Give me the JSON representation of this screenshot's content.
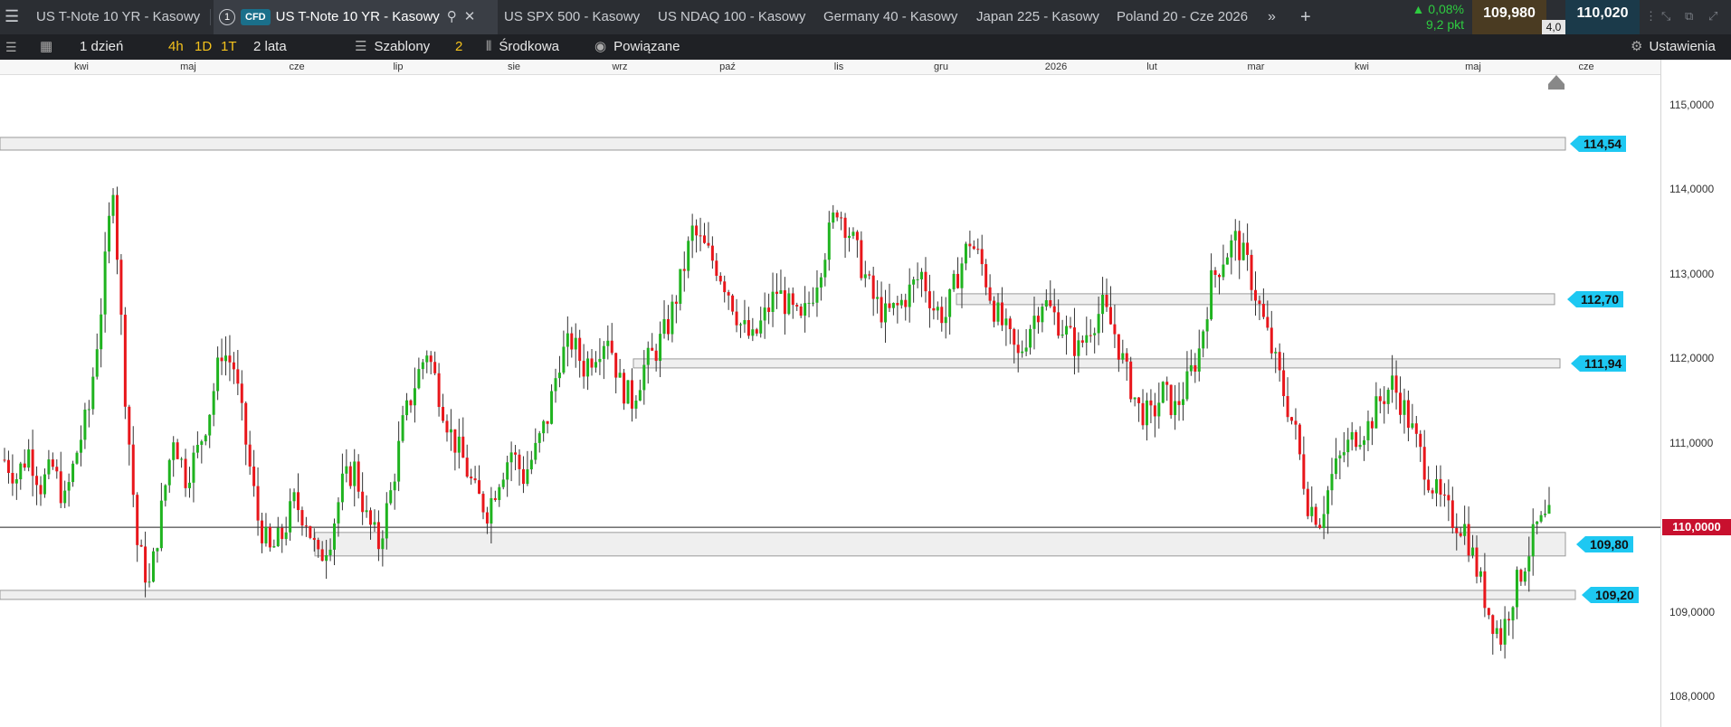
{
  "tabs": [
    {
      "label": "US T-Note 10 YR - Kasowy"
    },
    {
      "label": "US T-Note 10 YR - Kasowy",
      "index": "1",
      "badge": "CFD"
    },
    {
      "label": "US SPX 500 - Kasowy"
    },
    {
      "label": "US NDAQ 100 - Kasowy"
    },
    {
      "label": "Germany 40 - Kasowy"
    },
    {
      "label": "Japan 225 - Kasowy"
    },
    {
      "label": "Poland 20 - Cze 2026"
    }
  ],
  "quote": {
    "change_pct": "▲ 0,08%",
    "change_pts": "9,2 pkt",
    "sell": "109,980",
    "buy": "110,020",
    "spread": "4,0"
  },
  "toolbar": {
    "interval": "1 dzień",
    "tf1": "4h",
    "tf2": "1D",
    "tf3": "1T",
    "range": "2 lata",
    "templates": "Szablony",
    "templates_count": "2",
    "indicator": "Środkowa",
    "linked": "Powiązane",
    "settings": "Ustawienia"
  },
  "axis": {
    "months": [
      "kwi",
      "maj",
      "cze",
      "lip",
      "sie",
      "wrz",
      "paź",
      "lis",
      "gru",
      "2026",
      "lut",
      "mar",
      "kwi",
      "maj",
      "cze"
    ],
    "prices": [
      "115,0000",
      "114,0000",
      "113,0000",
      "112,0000",
      "111,0000",
      "110,0000",
      "109,0000",
      "108,0000"
    ],
    "current_price": "110,0000"
  },
  "levels": [
    "114,54",
    "112,70",
    "111,94",
    "109,80",
    "109,20"
  ],
  "colors": {
    "up": "#1fb31f",
    "down": "#e8161b",
    "tag": "#1ec8f2",
    "current": "#c8102e"
  },
  "chart_data": {
    "type": "candlestick",
    "ylim": [
      107.8,
      115.3
    ],
    "price_levels": [
      114.54,
      112.7,
      111.94,
      109.8,
      109.2
    ],
    "current": 110.0,
    "months": [
      "kwi",
      "maj",
      "cze",
      "lip",
      "sie",
      "wrz",
      "paź",
      "lis",
      "gru",
      "2026",
      "lut",
      "mar",
      "kwi",
      "maj",
      "cze"
    ],
    "path": [
      110.8,
      110.6,
      110.9,
      110.5,
      110.7,
      110.3,
      110.9,
      111.4,
      112.6,
      114.1,
      111.6,
      109.8,
      109.3,
      110.2,
      111.1,
      110.6,
      110.9,
      111.4,
      112.1,
      111.9,
      111.0,
      110.1,
      109.7,
      109.9,
      110.3,
      110.1,
      109.6,
      109.9,
      110.5,
      110.7,
      110.1,
      109.8,
      110.4,
      111.2,
      111.7,
      112.1,
      111.6,
      111.1,
      110.8,
      110.4,
      110.2,
      110.6,
      110.9,
      110.6,
      110.9,
      111.3,
      112.0,
      112.2,
      111.9,
      112.1,
      112.3,
      111.7,
      111.5,
      111.9,
      112.1,
      112.4,
      112.9,
      113.5,
      113.3,
      113.1,
      112.8,
      112.4,
      112.2,
      112.5,
      112.8,
      112.6,
      112.4,
      112.8,
      113.3,
      113.8,
      113.5,
      113.1,
      112.7,
      112.5,
      112.6,
      112.8,
      113.0,
      112.6,
      112.5,
      113.0,
      113.4,
      113.1,
      112.6,
      112.3,
      112.0,
      112.4,
      112.7,
      112.5,
      112.3,
      112.1,
      112.4,
      112.6,
      112.3,
      111.8,
      111.4,
      111.3,
      111.6,
      111.4,
      111.7,
      112.1,
      112.9,
      113.2,
      113.4,
      113.1,
      112.6,
      112.1,
      111.6,
      111.1,
      110.3,
      110.1,
      110.6,
      110.9,
      111.1,
      111.2,
      111.5,
      111.7,
      111.4,
      111.0,
      110.6,
      110.3,
      110.1,
      110.0,
      109.5,
      109.0,
      108.7,
      109.2,
      109.6,
      110.0,
      110.1
    ],
    "xlabel": "",
    "ylabel": ""
  }
}
